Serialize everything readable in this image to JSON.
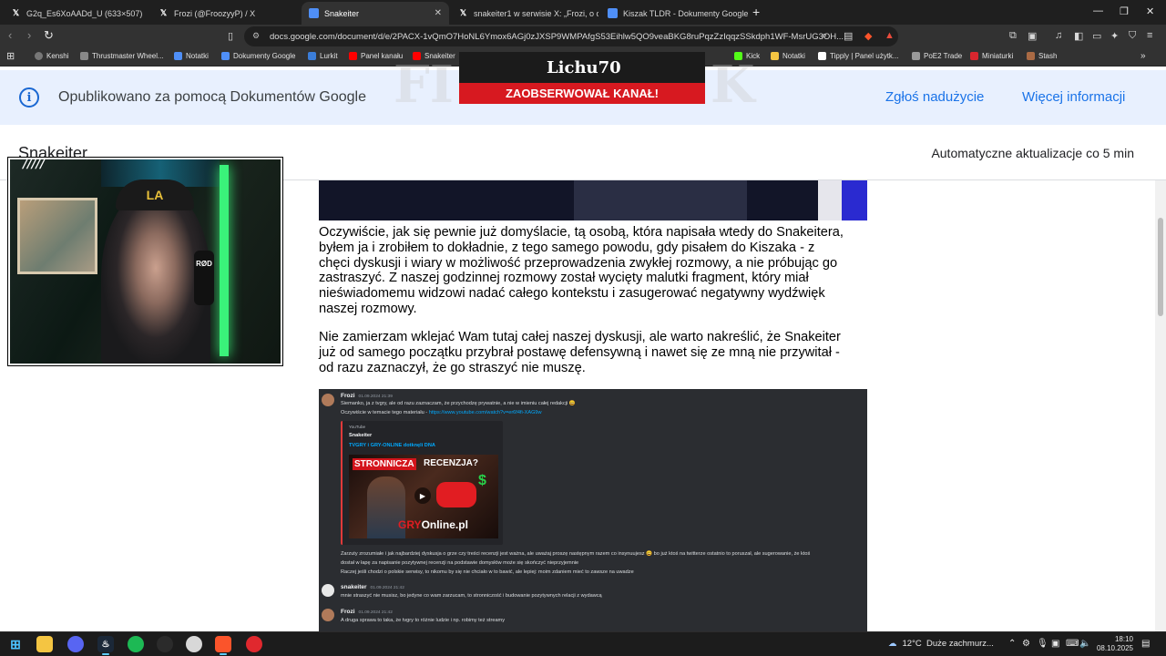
{
  "browser": {
    "tabs": [
      {
        "label": "G2q_Es6XoAADd_U (633×507)",
        "icon": "x-logo-icon",
        "active": false
      },
      {
        "label": "Frozi (@FroozyyP) / X",
        "icon": "x-logo-icon",
        "active": false
      },
      {
        "label": "Snakeiter",
        "icon": "docs-icon",
        "active": true
      },
      {
        "label": "snakeiter1 w serwisie X: „Frozi, o co c",
        "icon": "x-logo-icon",
        "active": false
      },
      {
        "label": "Kiszak TLDR - Dokumenty Google",
        "icon": "docs-icon",
        "active": false
      }
    ],
    "url": "docs.google.com/document/d/e/2PACX-1vQmO7HoNL6Ymox6AGj0zJXSP9WMPAfgS53Eihlw5QO9veaBKG8ruPqzZzIqqzSSkdph1WF-MsrUG3OH..."
  },
  "bookmarks": [
    {
      "label": "Kenshi",
      "color": "#777777"
    },
    {
      "label": "Thrustmaster Wheel...",
      "color": "#888888"
    },
    {
      "label": "Notatki",
      "color": "#4f8ff7"
    },
    {
      "label": "Dokumenty Google",
      "color": "#4f8ff7"
    },
    {
      "label": "Lurkit",
      "color": "#3b7dd8"
    },
    {
      "label": "Panel kanału",
      "color": "#ff0000"
    },
    {
      "label": "Snakeiter",
      "color": "#ff0000"
    },
    {
      "label": "Kick",
      "color": "#53fc18"
    },
    {
      "label": "Notatki",
      "color": "#f4c542"
    },
    {
      "label": "Tipply | Panel użytk...",
      "color": "#111111"
    },
    {
      "label": "PoE2 Trade",
      "color": "#999999"
    },
    {
      "label": "Miniaturki",
      "color": "#d9262e"
    },
    {
      "label": "Stash",
      "color": "#aa6a44"
    }
  ],
  "banner": {
    "published": "Opublikowano za pomocą Dokumentów Google",
    "report": "Zgłoś nadużycie",
    "more": "Więcej informacji"
  },
  "doc": {
    "title": "Snakeiter",
    "autoupdate": "Automatyczne aktualizacje co 5 min",
    "paragraphs": [
      "Oczywiście, jak się pewnie już domyślacie, tą osobą, która napisała wtedy do Snakeitera, byłem ja i zrobiłem to dokładnie, z tego samego powodu, gdy pisałem do Kiszaka - z chęci dyskusji i wiary w możliwość przeprowadzenia zwykłej rozmowy, a nie próbując go zastraszyć. Z naszej godzinnej rozmowy został wycięty malutki fragment, który miał nieświadomemu widzowi nadać całego kontekstu i zasugerować negatywny wydźwięk naszej rozmowy.",
      "Nie zamierzam wklejać Wam tutaj całej naszej dyskusji, ale warto nakreślić, że Snakeiter już od samego początku przybrał postawę defensywną i nawet się ze mną nie przywitał - od razu zaznaczył, że go straszyć nie muszę."
    ]
  },
  "discord": {
    "msg1": {
      "user": "Frozi",
      "time": "01.09.2024 21:39",
      "line1": "Siemanko, ja z tvgry, ale od razu zaznaczam, że przychodzę prywatnie, a nie w imieniu całej redakcji 😀",
      "line2_prefix": "Oczywiście w temacie tego materiału - ",
      "line2_link": "https://www.youtube.com/watch?v=er6f4fi-XAG9w"
    },
    "embed": {
      "provider": "YouTube",
      "author": "Snakeiter",
      "title": "TVGRY i GRY-ONLINE dotknęli DNA",
      "thumb_t1": "STRONNICZA",
      "thumb_t2": "RECENZJA?",
      "thumb_logo_a": "GRY",
      "thumb_logo_b": "Online.pl"
    },
    "msg1_more": [
      "Zarzuty zrozumiałe i jak najbardziej dyskusja o grze czy treści recenzji jest ważna, ale uważaj proszę następnym razem co insynuujesz 😀 bo już ktoś na twitterze ostatnio to poruszał, ale sugerowanie, że ktoś",
      "dostał w łapę za napisanie pozytywnej recenzji na podstawie domysłów może się skończyć nieprzyjemnie",
      "Raczej jeśli chodzi o polskie serwisy, to nikomu by się nie chciało w to bawić, ale lepiej: moim zdaniem mieć to zawsze na uwadze"
    ],
    "msg2": {
      "user": "snakeiter",
      "time": "01.09.2024 21:42",
      "line": "mnie straszyć nie musisz, bo jedyne co wam zarzucam, to stronniczość i budowanie pozytywnych relacji z wydawcą"
    },
    "msg3": {
      "user": "Frozi",
      "time": "01.09.2024 21:42",
      "line": "A druga sprawa to taka, że tvgry to różnie ludzie i np. robimy też streamy"
    }
  },
  "overlay": {
    "name": "Lichu70",
    "action": "ZAOBSERWOWAŁ KANAŁ!",
    "ghost1": "FI",
    "ghost2": "K",
    "mic_brand": "RØD",
    "cap_logo": "LA",
    "webcam_tag": "/////"
  },
  "taskbar": {
    "weather_temp": "12°C",
    "weather_desc": "Duże zachmurz...",
    "time": "18:10",
    "date": "08.10.2025"
  }
}
